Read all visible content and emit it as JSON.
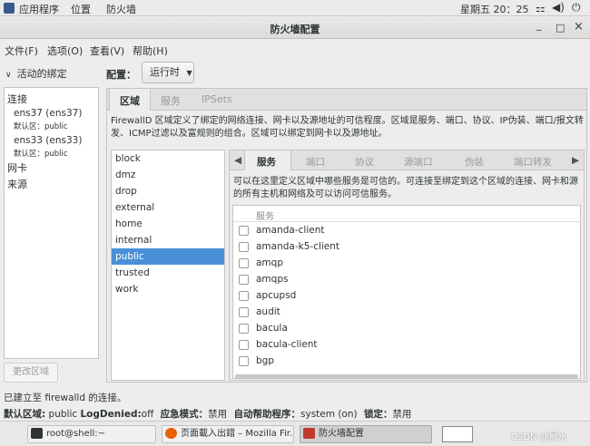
{
  "top_panel": {
    "apps": "应用程序",
    "places": "位置",
    "firewall": "防火墙",
    "clock": "星期五 20：25"
  },
  "window": {
    "title": "防火墙配置",
    "minimize": "_",
    "maximize": "□",
    "close": "×"
  },
  "menubar": {
    "file": "文件(F)",
    "options": "选项(O)",
    "view": "查看(V)",
    "help": "帮助(H)"
  },
  "sidebar": {
    "toggle_label": "活动的绑定",
    "connections_header": "连接",
    "connections": [
      {
        "name": "ens37 (ens37)",
        "zone": "默认区：public"
      },
      {
        "name": "ens33 (ens33)",
        "zone": "默认区：public"
      }
    ],
    "interfaces_header": "网卡",
    "sources_header": "来源",
    "change_zone_button": "更改区域"
  },
  "config": {
    "label": "配置：",
    "value": "运行时"
  },
  "main_tabs": [
    "区域",
    "服务",
    "IPSets"
  ],
  "zone_description": "FirewallD 区域定义了绑定的网络连接、网卡以及源地址的可信程度。区域是服务、端口、协议、IP伪装、端口/报文转发、ICMP过滤以及富规则的组合。区域可以绑定到网卡以及源地址。",
  "zones": [
    "block",
    "dmz",
    "drop",
    "external",
    "home",
    "internal",
    "public",
    "trusted",
    "work"
  ],
  "selected_zone": "public",
  "zone_tabs": [
    "服务",
    "端口",
    "协议",
    "源端口",
    "伪装",
    "端口转发"
  ],
  "services_description": "可以在这里定义区域中哪些服务是可信的。可连接至绑定到这个区域的连接、网卡和源的所有主机和网络及可以访问可信服务。",
  "services_header": "服务",
  "services": [
    "amanda-client",
    "amanda-k5-client",
    "amqp",
    "amqps",
    "apcupsd",
    "audit",
    "bacula",
    "bacula-client",
    "bgp"
  ],
  "status": {
    "connection": "已建立至  firewalld 的连接。",
    "default_zone_label": "默认区域:",
    "default_zone": "public",
    "log_denied_label": "LogDenied:",
    "log_denied": "off",
    "panic_label": "应急模式：",
    "panic": "禁用",
    "helper_label": "自动帮助程序：",
    "helper": "system (on)",
    "lockdown_label": "锁定：",
    "lockdown": "禁用"
  },
  "taskbar": [
    {
      "label": "root@shell:~",
      "icon": "terminal-icon"
    },
    {
      "label": "页面載入出錯 – Mozilla Fir...",
      "icon": "firefox-icon"
    },
    {
      "label": "防火墙配置",
      "icon": "firewall-icon"
    }
  ],
  "watermark": "CSDN @晨水"
}
